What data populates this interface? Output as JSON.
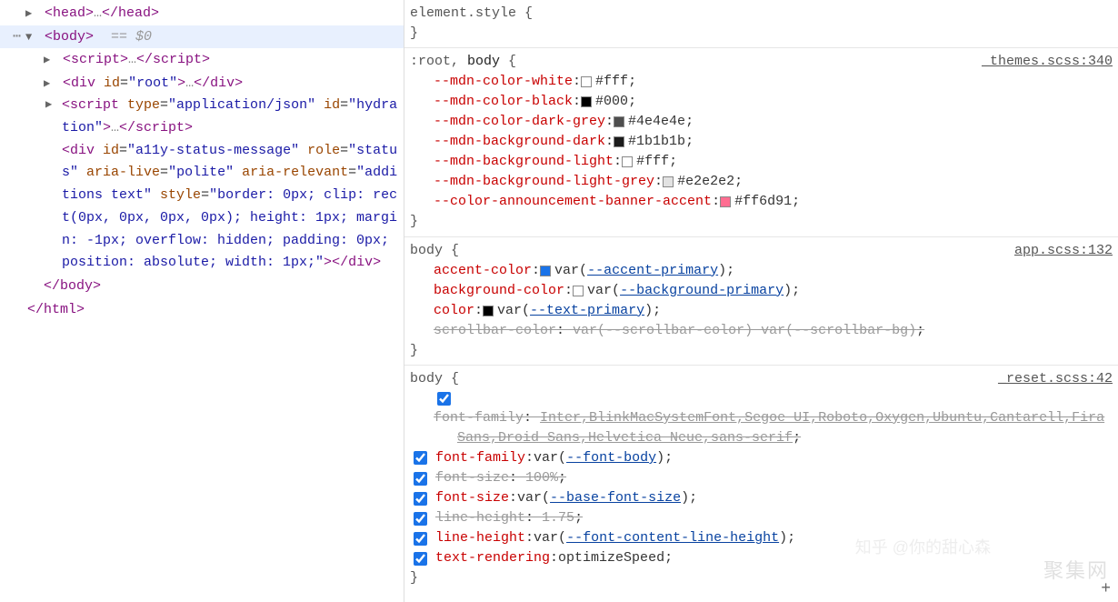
{
  "dom": {
    "head": {
      "open": "<head>",
      "ell": "…",
      "close": "</head>"
    },
    "body_open": "<body>",
    "body_hint": "== $0",
    "script1": {
      "open": "<script>",
      "ell": "…",
      "close": "</script>"
    },
    "div_root": {
      "open": "<div ",
      "id_attr": "id",
      "id_val": "\"root\"",
      "gt": ">",
      "ell": "…",
      "close": "</div>"
    },
    "script2": {
      "open": "<script ",
      "type_attr": "type",
      "type_val": "\"application/json\"",
      "id_attr": "id",
      "id_val": "\"hydration\"",
      "gt": ">",
      "ell": "…",
      "close": "</script>"
    },
    "div_a11y": {
      "open": "<div ",
      "id_attr": "id",
      "id_val": "\"a11y-status-message\"",
      "role_attr": "role",
      "role_val": "\"status\"",
      "aria_live_attr": "aria-live",
      "aria_live_val": "\"polite\"",
      "aria_rel_attr": "aria-relevant",
      "aria_rel_val": "\"additions text\"",
      "style_attr": "style",
      "style_val": "\"border: 0px; clip: rect(0px, 0px, 0px, 0px); height: 1px; margin: -1px; overflow: hidden; padding: 0px; position: absolute; width: 1px;\"",
      "gt": ">",
      "close": "</div>"
    },
    "body_close": "</body>",
    "html_close": "</html>"
  },
  "styles": {
    "elementStyle": {
      "selector": "element.style",
      "open": "{",
      "close": "}"
    },
    "root": {
      "selector": ":root, ",
      "selector_hl": "body",
      "open": "{",
      "close": "}",
      "src": "_themes.scss:340",
      "props": [
        {
          "name": "--mdn-color-white",
          "swatch": "#ffffff",
          "val": "#fff"
        },
        {
          "name": "--mdn-color-black",
          "swatch": "#000000",
          "val": "#000"
        },
        {
          "name": "--mdn-color-dark-grey",
          "swatch": "#4e4e4e",
          "val": "#4e4e4e"
        },
        {
          "name": "--mdn-background-dark",
          "swatch": "#1b1b1b",
          "val": "#1b1b1b"
        },
        {
          "name": "--mdn-background-light",
          "swatch": "#ffffff",
          "val": "#fff"
        },
        {
          "name": "--mdn-background-light-grey",
          "swatch": "#e2e2e2",
          "val": "#e2e2e2"
        },
        {
          "name": "--color-announcement-banner-accent",
          "swatch": "#ff6d91",
          "val": "#ff6d91"
        }
      ]
    },
    "app": {
      "selector": "body",
      "open": "{",
      "close": "}",
      "src": "app.scss:132",
      "props": [
        {
          "name": "accent-color",
          "swatch": "#1a73e8",
          "prefix": "var(",
          "var": "--accent-primary",
          "suffix": ")"
        },
        {
          "name": "background-color",
          "swatch": "#ffffff",
          "prefix": "var(",
          "var": "--background-primary",
          "suffix": ")"
        },
        {
          "name": "color",
          "swatch": "#000000",
          "prefix": "var(",
          "var": "--text-primary",
          "suffix": ")"
        },
        {
          "name": "scrollbar-color",
          "val": "var(--scrollbar-color) var(--scrollbar-bg)",
          "strike": true
        }
      ]
    },
    "reset": {
      "selector": "body",
      "open": "{",
      "close": "}",
      "src": "_reset.scss:42",
      "props": [
        {
          "chk": true,
          "name": "font-family",
          "val": "Inter,BlinkMacSystemFont,Segoe UI,Roboto,Oxygen,Ubuntu,Cantarell,Fira Sans,Droid Sans,Helvetica Neue,sans-serif",
          "strike": true,
          "underline": true
        },
        {
          "chk": true,
          "name": "font-family",
          "prefix": "var(",
          "var": "--font-body",
          "suffix": ")"
        },
        {
          "chk": true,
          "name": "font-size",
          "val": "100%",
          "strike": true
        },
        {
          "chk": true,
          "name": "font-size",
          "prefix": "var(",
          "var": "--base-font-size",
          "suffix": ")"
        },
        {
          "chk": true,
          "name": "line-height",
          "val": "1.75",
          "strike": true
        },
        {
          "chk": true,
          "name": "line-height",
          "prefix": "var(",
          "var": "--font-content-line-height",
          "suffix": ")"
        },
        {
          "chk": true,
          "name": "text-rendering",
          "val": "optimizeSpeed"
        }
      ]
    }
  },
  "watermark": "聚集网",
  "watermark2": "知乎 @你的甜心森",
  "add_symbol": "+"
}
